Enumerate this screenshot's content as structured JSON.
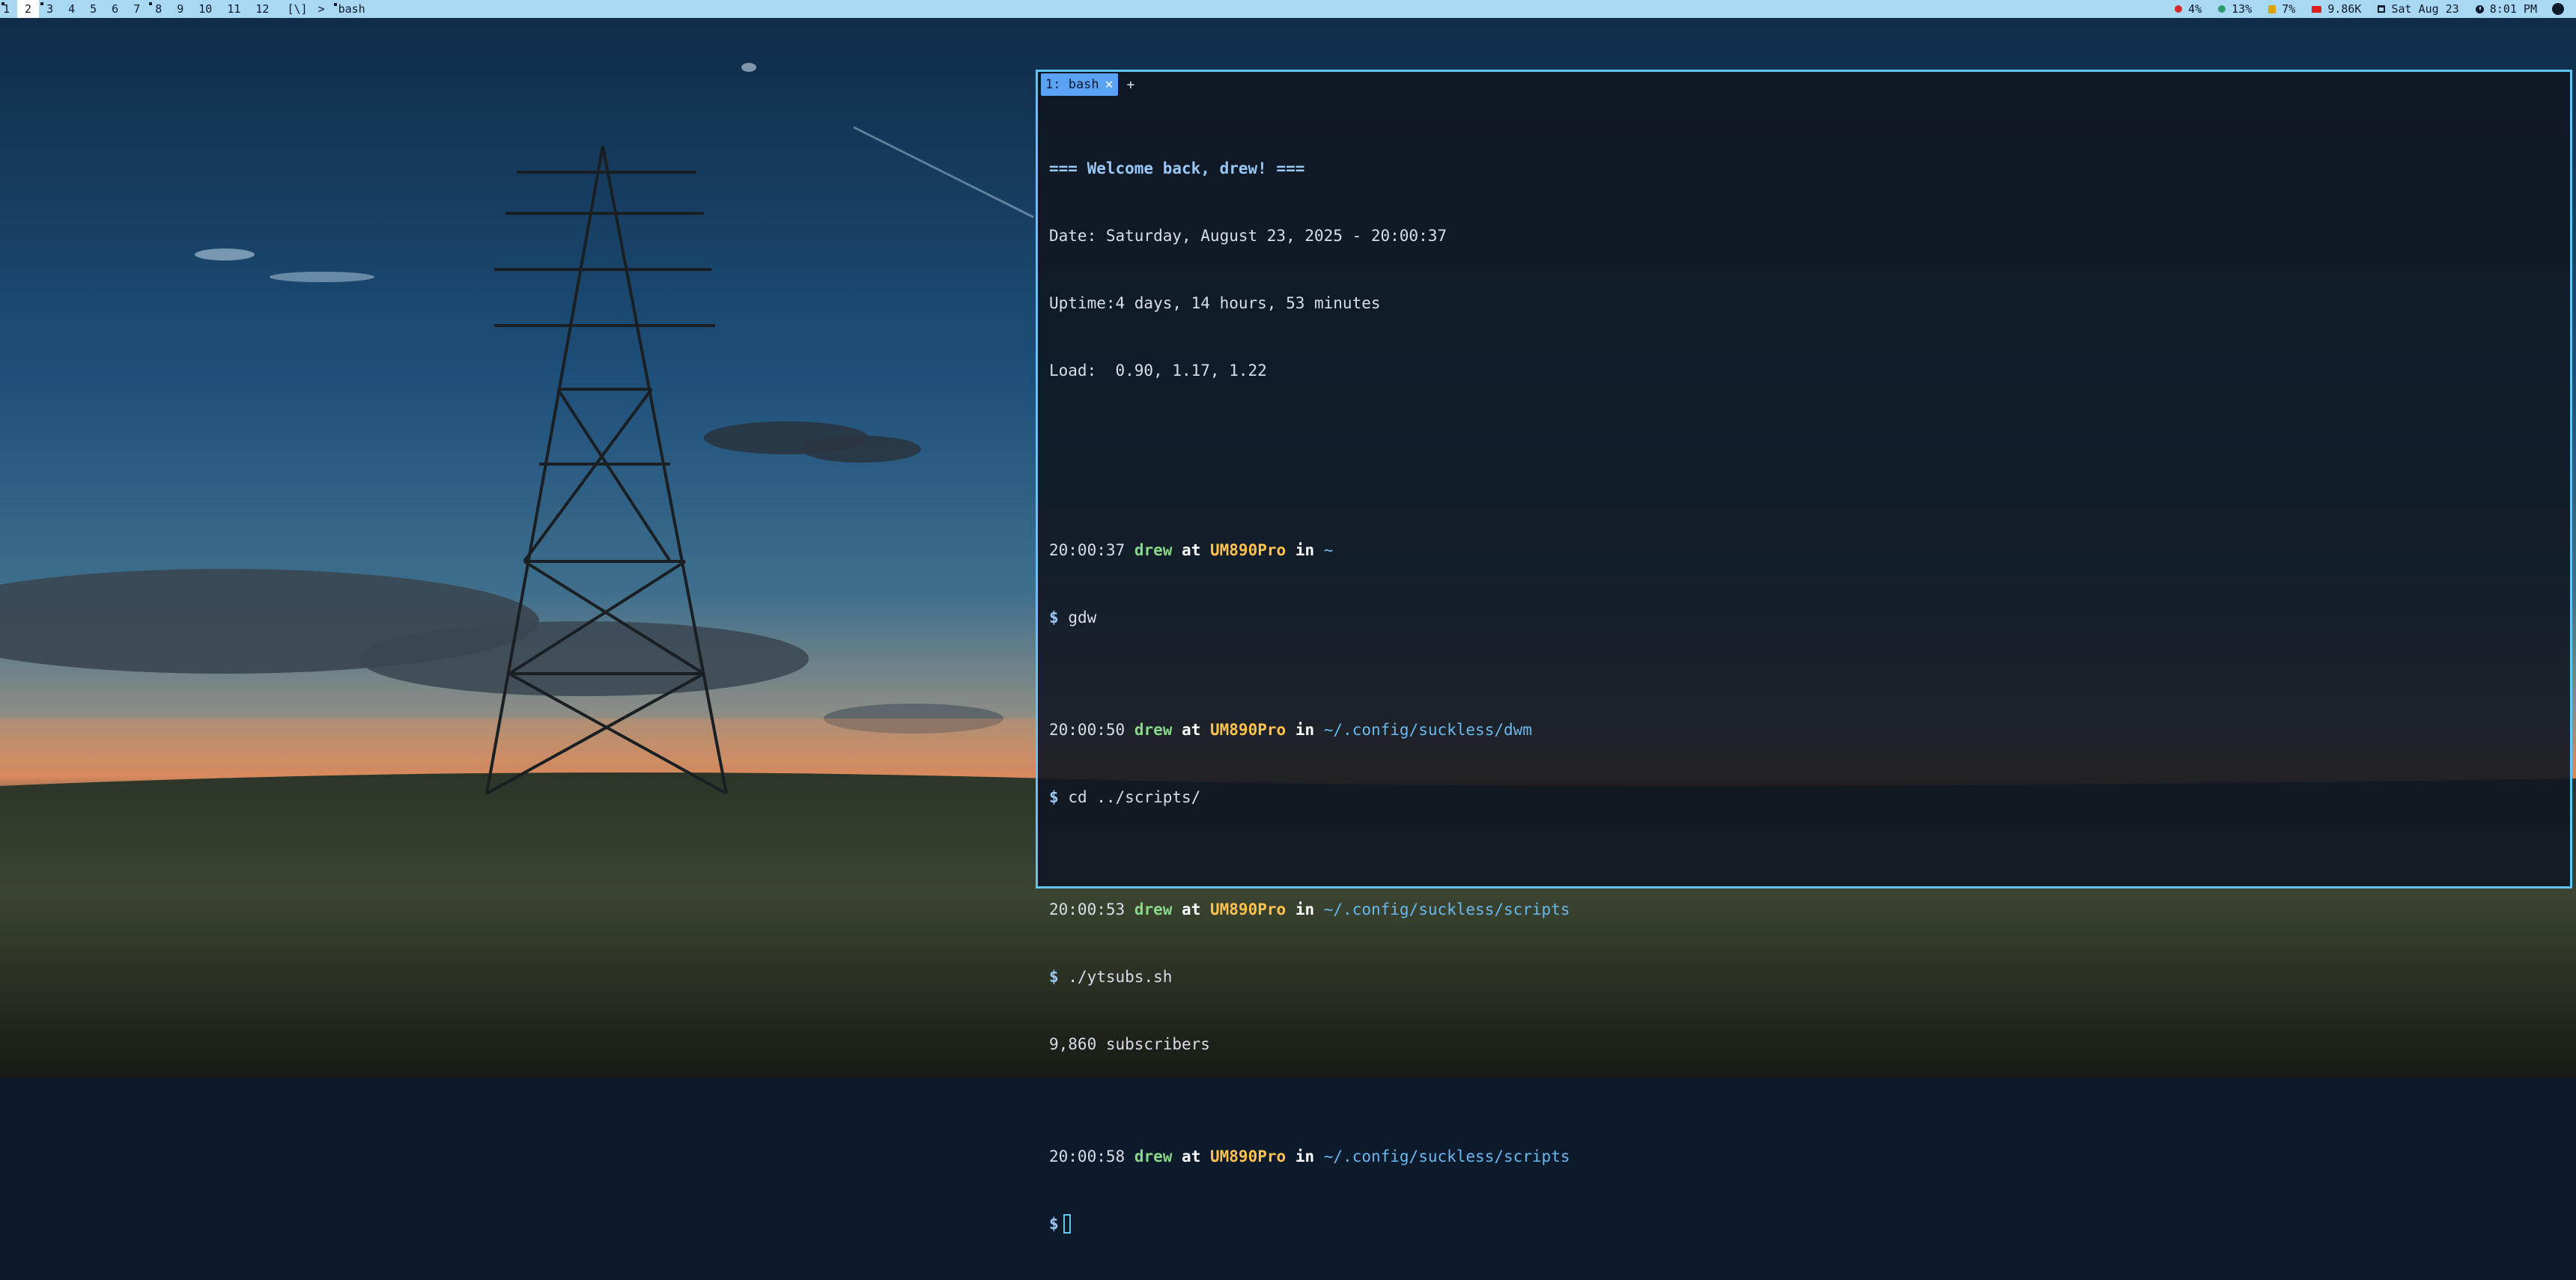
{
  "topbar": {
    "tags": [
      {
        "label": "1",
        "occupied": true,
        "selected": false
      },
      {
        "label": "2",
        "occupied": true,
        "selected": true
      },
      {
        "label": "3",
        "occupied": true,
        "selected": false
      },
      {
        "label": "4",
        "occupied": false,
        "selected": false
      },
      {
        "label": "5",
        "occupied": false,
        "selected": false
      },
      {
        "label": "6",
        "occupied": false,
        "selected": false
      },
      {
        "label": "7",
        "occupied": false,
        "selected": false
      },
      {
        "label": "8",
        "occupied": true,
        "selected": false
      },
      {
        "label": "9",
        "occupied": false,
        "selected": false
      },
      {
        "label": "10",
        "occupied": false,
        "selected": false
      },
      {
        "label": "11",
        "occupied": false,
        "selected": false
      },
      {
        "label": "12",
        "occupied": false,
        "selected": false
      }
    ],
    "layout_symbol": "[\\]",
    "arrow": ">",
    "window_title": "bash",
    "status": {
      "cpu": "4%",
      "memory": "13%",
      "disk": "7%",
      "subscribers": "9.86K",
      "date": "Sat Aug 23",
      "time": "8:01 PM"
    },
    "colors": {
      "bar_bg": "#a9d8f2",
      "cpu_icon": "#d62a2a",
      "memory_icon": "#2a9d6a",
      "disk_icon": "#e0a000",
      "youtube_icon": "#e01e1e"
    }
  },
  "terminal": {
    "tab_label": "1: bash",
    "tab_close": "✕",
    "new_tab": "+",
    "welcome": "=== Welcome back, drew! ===",
    "date_line": "Date: Saturday, August 23, 2025 - 20:00:37",
    "uptime_line": "Uptime:4 days, 14 hours, 53 minutes",
    "load_line": "Load:  0.90, 1.17, 1.22",
    "user": "drew",
    "at": "at",
    "host": "UM890Pro",
    "in": "in",
    "prompt_symbol": "$",
    "prompts": [
      {
        "time": "20:00:37",
        "path": "~",
        "command": "gdw"
      },
      {
        "time": "20:00:50",
        "path": "~/.config/suckless/dwm",
        "command": "cd ../scripts/"
      },
      {
        "time": "20:00:53",
        "path": "~/.config/suckless/scripts",
        "command": "./ytsubs.sh"
      },
      {
        "time": "20:00:58",
        "path": "~/.config/suckless/scripts",
        "command": ""
      }
    ],
    "output_line": "9,860 subscribers",
    "colors": {
      "border": "#5ec6f0",
      "tab_bg": "#5aa2f5",
      "user": "#88d88a",
      "host": "#ffc14d",
      "path": "#6ab8f0"
    }
  }
}
